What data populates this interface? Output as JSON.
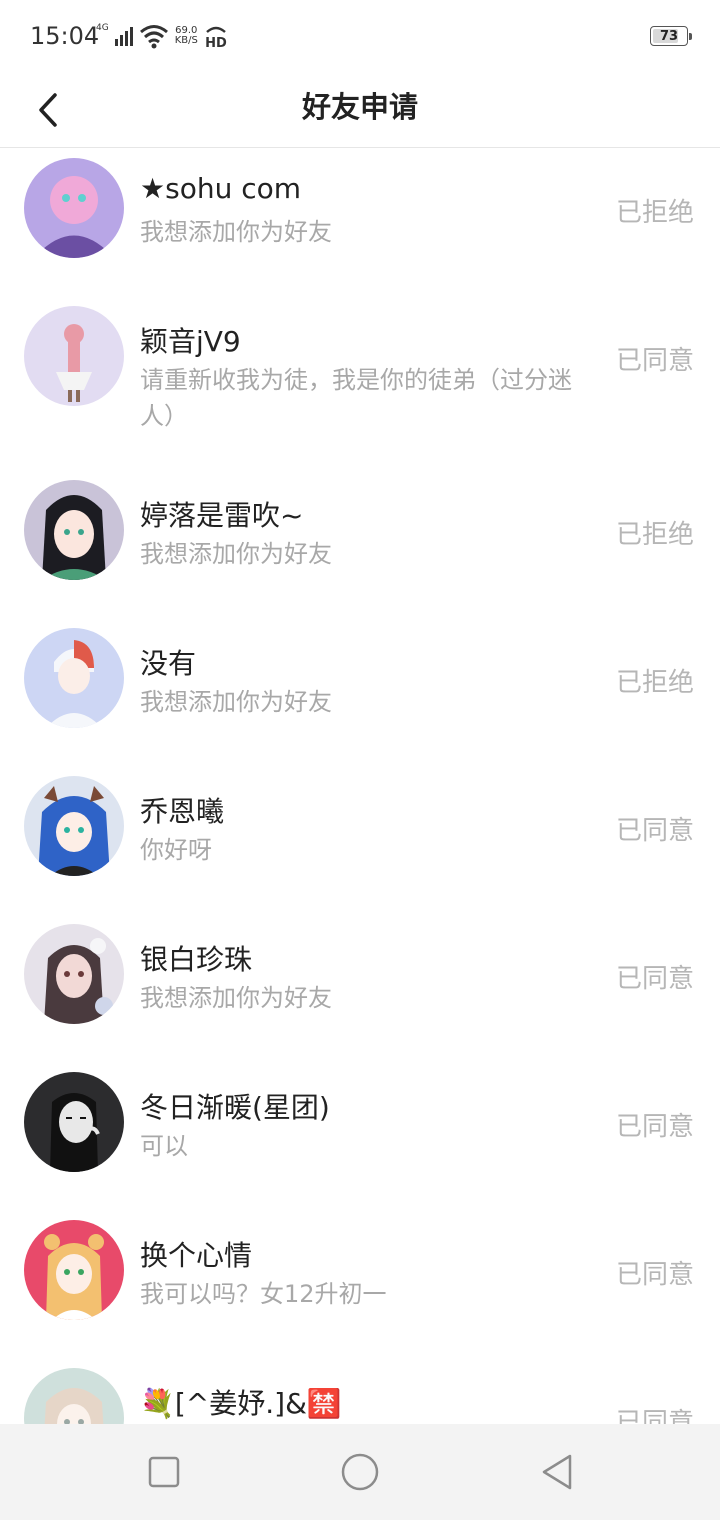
{
  "status_bar": {
    "time": "15:04",
    "network": "4G",
    "speed_value": "69.0",
    "speed_unit": "KB/S",
    "battery": "73"
  },
  "header": {
    "title": "好友申请"
  },
  "requests": [
    {
      "name": "★sohu com",
      "message": "我想添加你为好友",
      "status": "已拒绝",
      "avatar_colors": [
        "#b8a6e6",
        "#f0a9d8",
        "#6b4fa3"
      ]
    },
    {
      "name": "颖音jV9",
      "message": "请重新收我为徒，我是你的徒弟（过分迷人）",
      "status": "已同意",
      "avatar_colors": [
        "#e2dcf2",
        "#e89aa6",
        "#8a6a5a"
      ]
    },
    {
      "name": "婷落是雷吹~",
      "message": "我想添加你为好友",
      "status": "已拒绝",
      "avatar_colors": [
        "#c9c3d8",
        "#1c1c22",
        "#4a9e78"
      ]
    },
    {
      "name": "没有",
      "message": "我想添加你为好友",
      "status": "已拒绝",
      "avatar_colors": [
        "#cdd6f4",
        "#e05a4a",
        "#f5f7fb"
      ]
    },
    {
      "name": "乔恩曦",
      "message": "你好呀",
      "status": "已同意",
      "avatar_colors": [
        "#dde4f0",
        "#2f63c7",
        "#7a4a36"
      ]
    },
    {
      "name": "银白珍珠",
      "message": "我想添加你为好友",
      "status": "已同意",
      "avatar_colors": [
        "#e6e2ea",
        "#4a3a3e",
        "#f2d9d6"
      ]
    },
    {
      "name": "冬日渐暖(星团)",
      "message": "可以",
      "status": "已同意",
      "avatar_colors": [
        "#2c2c2e",
        "#e8e8e8",
        "#111111"
      ]
    },
    {
      "name": "换个心情",
      "message": "我可以吗？女12升初一",
      "status": "已同意",
      "avatar_colors": [
        "#e84a6a",
        "#f3c070",
        "#ffffff"
      ]
    },
    {
      "name": "💐[^姜妤.]&🈲",
      "message": "",
      "status": "已同意",
      "avatar_colors": [
        "#cfe0dc",
        "#e6d6c8",
        "#9aa8a4"
      ]
    }
  ]
}
